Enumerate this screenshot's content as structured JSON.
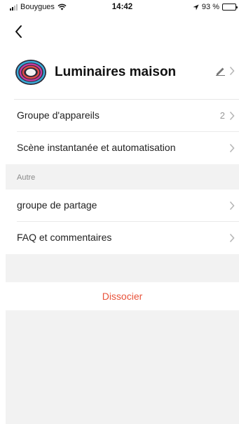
{
  "status_bar": {
    "carrier": "Bouygues",
    "time": "14:42",
    "battery": "93 %",
    "battery_level": 0.93
  },
  "nav": {
    "back_icon": "chevron-left-icon"
  },
  "header": {
    "title": "Luminaires maison",
    "edit_icon": "pencil-icon"
  },
  "rows": {
    "group": {
      "label": "Groupe d'appareils",
      "value": "2"
    },
    "scene": {
      "label": "Scène instantanée et automatisation"
    }
  },
  "section": {
    "title": "Autre"
  },
  "other_rows": {
    "share": {
      "label": "groupe de partage"
    },
    "faq": {
      "label": "FAQ et commentaires"
    }
  },
  "action": {
    "label": "Dissocier",
    "color": "#e8523a"
  }
}
